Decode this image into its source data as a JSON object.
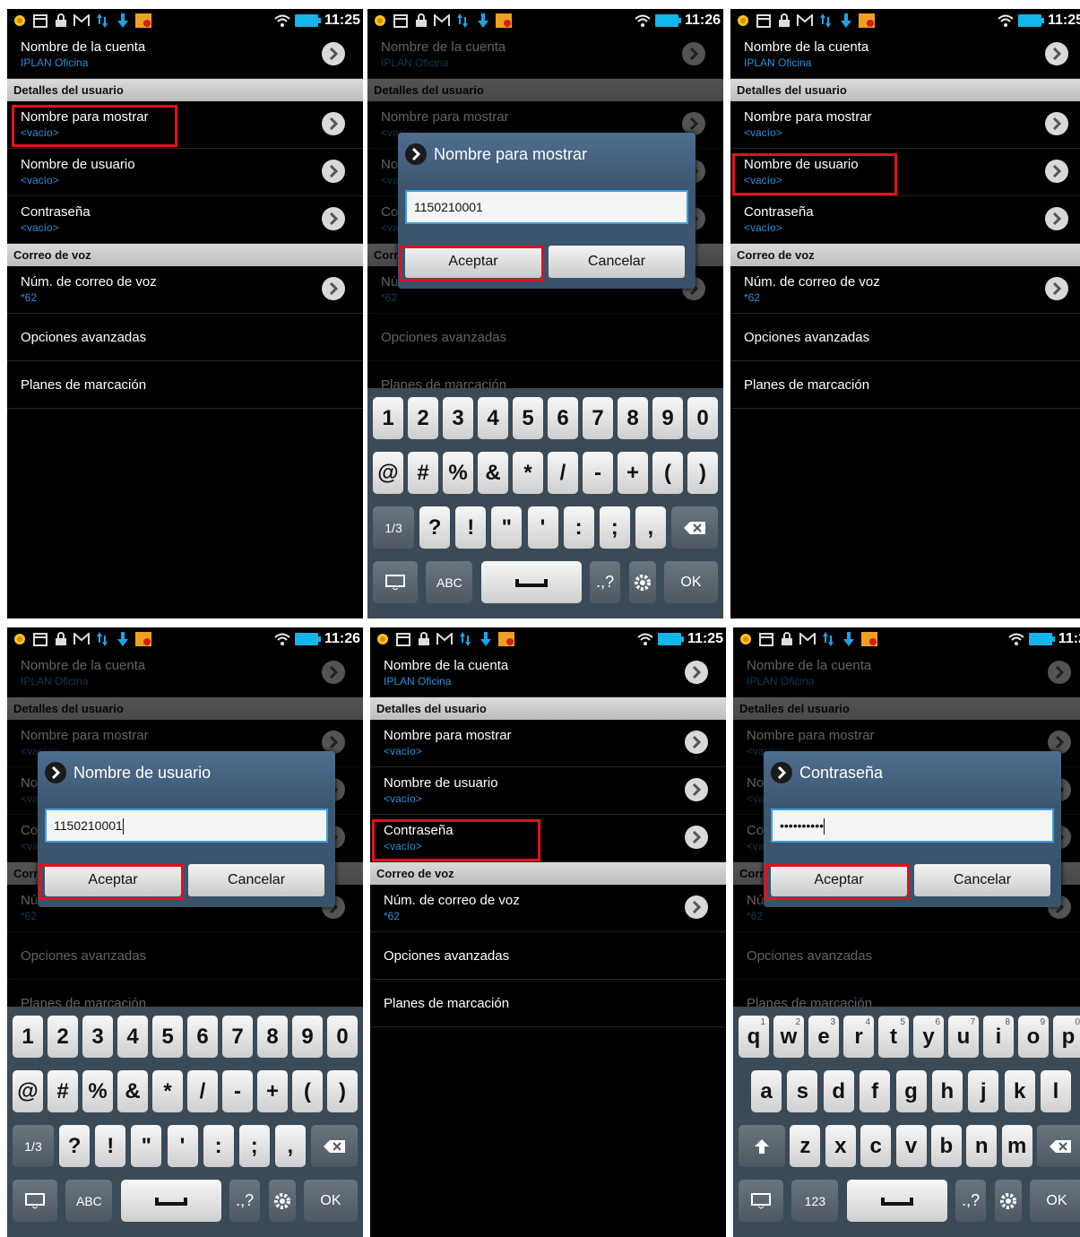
{
  "status": {
    "times": [
      "11:25",
      "11:26",
      "11:25",
      "11:26",
      "11:25",
      "11:2"
    ]
  },
  "list": {
    "account_name_label": "Nombre de la cuenta",
    "account_name_value": "IPLAN Oficina",
    "user_details_header": "Detalles del usuario",
    "display_name_label": "Nombre para mostrar",
    "display_name_value": "<vacío>",
    "username_label": "Nombre de usuario",
    "username_value": "<vacío>",
    "password_label": "Contraseña",
    "password_value": "<vacío>",
    "voicemail_header": "Correo de voz",
    "voicemail_number_label": "Núm. de correo de voz",
    "voicemail_number_value": "*62",
    "advanced_label": "Opciones avanzadas",
    "dialplan_label": "Planes de marcación"
  },
  "dialogs": {
    "display_name": {
      "title": "Nombre para mostrar",
      "value": "1150210001"
    },
    "username": {
      "title": "Nombre de usuario",
      "value": "1150210001"
    },
    "password": {
      "title": "Contraseña",
      "value": "••••••••••"
    },
    "ok_label": "Aceptar",
    "cancel_label": "Cancelar"
  },
  "keyboard": {
    "numbers": [
      "1",
      "2",
      "3",
      "4",
      "5",
      "6",
      "7",
      "8",
      "9",
      "0"
    ],
    "symbols1": [
      "@",
      "#",
      "%",
      "&",
      "*",
      "/",
      "-",
      "+",
      "(",
      ")"
    ],
    "symbols2": [
      "?",
      "!",
      "\"",
      "'",
      ":",
      ";",
      ","
    ],
    "page_label": "1/3",
    "abc_label": "ABC",
    "num_label": "123",
    "dotq_label": ".,?",
    "ok_label": "OK",
    "qwerty1": [
      "q",
      "w",
      "e",
      "r",
      "t",
      "y",
      "u",
      "i",
      "o",
      "p"
    ],
    "qwerty1_sup": [
      "1",
      "2",
      "3",
      "4",
      "5",
      "6",
      "7",
      "8",
      "9",
      "0"
    ],
    "qwerty2": [
      "a",
      "s",
      "d",
      "f",
      "g",
      "h",
      "j",
      "k",
      "l"
    ],
    "qwerty3": [
      "z",
      "x",
      "c",
      "v",
      "b",
      "n",
      "m"
    ]
  },
  "colors": {
    "highlight": "#e4101b",
    "accent": "#2b8fd6",
    "keyboard_bg": "#3b4a57"
  }
}
